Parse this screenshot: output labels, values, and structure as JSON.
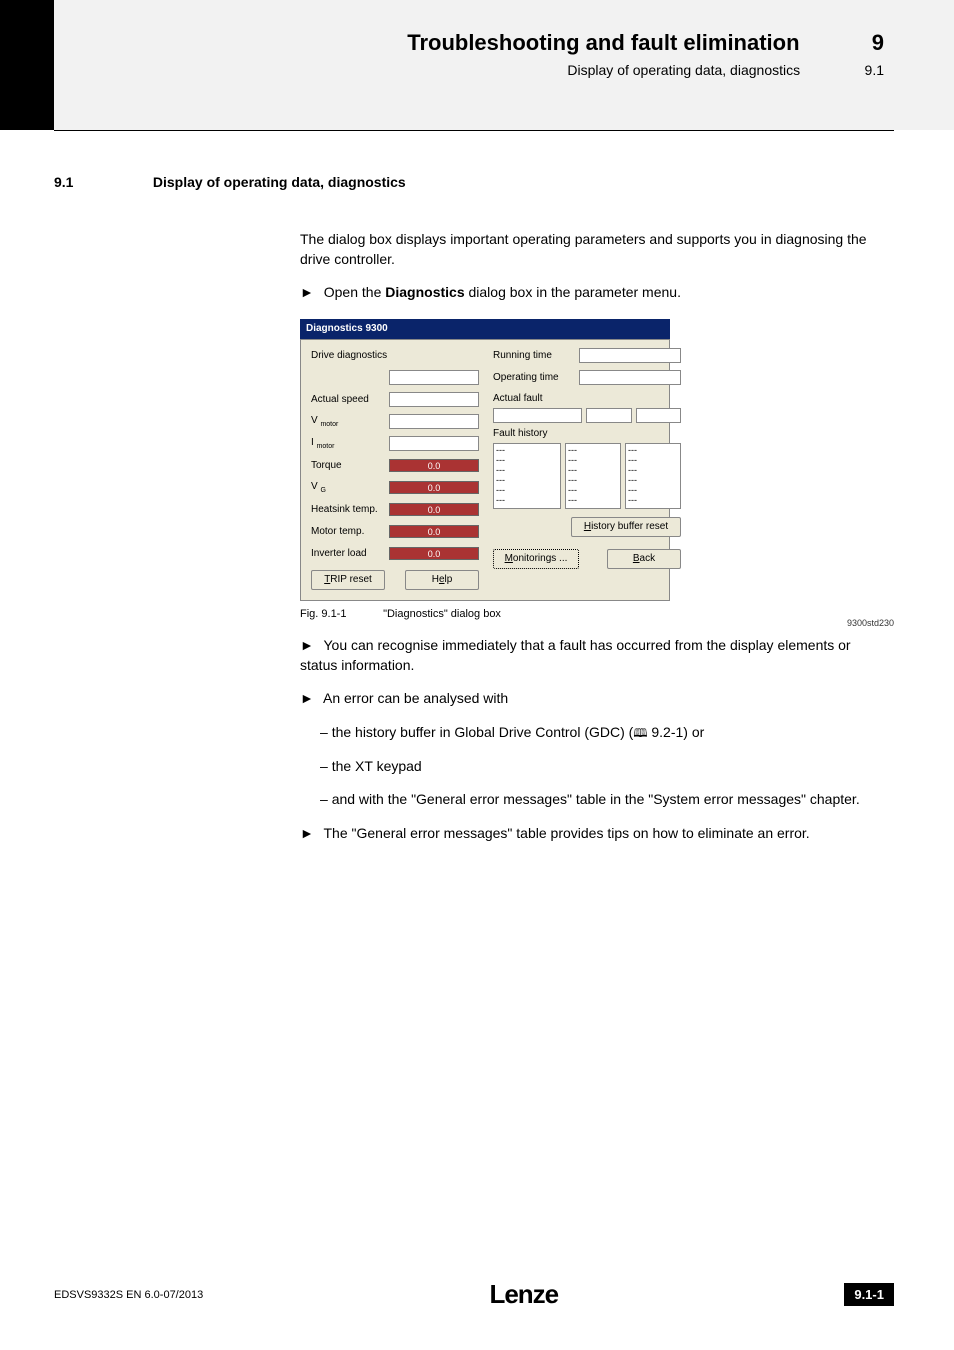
{
  "header": {
    "chapter_title": "Troubleshooting and fault elimination",
    "chapter_num": "9",
    "subtitle": "Display of operating data, diagnostics",
    "subtitle_num": "9.1"
  },
  "section": {
    "num": "9.1",
    "title": "Display of operating data, diagnostics"
  },
  "body": {
    "intro": "The dialog box displays important operating parameters and supports you in diagnosing the drive controller.",
    "open_line_prefix": "Open the ",
    "open_line_bold": "Diagnostics",
    "open_line_suffix": " dialog box in the parameter menu.",
    "fig_ref": "9300std230",
    "fig_caption_num": "Fig. 9.1-1",
    "fig_caption_text": "\"Diagnostics\" dialog box",
    "bullet1": "You can recognise immediately that a fault has occurred from the display elements or status information.",
    "bullet2": "An error can be analysed with",
    "dash1_prefix": "the history buffer in Global Drive Control (GDC) (",
    "dash1_ref": " 9.2-1) or",
    "dash2": "the XT keypad",
    "dash3": "and with the \"General error messages\" table in the \"System error messages\" chapter.",
    "bullet3": "The \"General error messages\" table provides tips on how to eliminate an error."
  },
  "dialog": {
    "title": "Diagnostics 9300",
    "left": {
      "drive_diagnostics": "Drive diagnostics",
      "actual_speed": "Actual speed",
      "v_motor": "V motor",
      "i_motor": "I motor",
      "torque": "Torque",
      "torque_val": "0.0",
      "vg": "V G",
      "vg_val": "0.0",
      "heatsink": "Heatsink temp.",
      "heatsink_val": "0.0",
      "motor_temp": "Motor temp.",
      "motor_temp_val": "0.0",
      "inverter_load": "Inverter load",
      "inverter_load_val": "0.0",
      "trip_reset": "TRIP reset",
      "help": "Help"
    },
    "right": {
      "running_time": "Running time",
      "operating_time": "Operating time",
      "actual_fault": "Actual fault",
      "fault_history": "Fault history",
      "dots": "---",
      "history_reset": "History buffer reset",
      "monitorings": "Monitorings ...",
      "back": "Back"
    }
  },
  "chart_data": {
    "type": "table",
    "title": "Diagnostics 9300 — progress bars",
    "categories": [
      "Torque",
      "V_G",
      "Heatsink temp.",
      "Motor temp.",
      "Inverter load"
    ],
    "values": [
      0.0,
      0.0,
      0.0,
      0.0,
      0.0
    ]
  },
  "footer": {
    "doc": "EDSVS9332S EN 6.0-07/2013",
    "logo": "Lenze",
    "page": "9.1-1"
  }
}
